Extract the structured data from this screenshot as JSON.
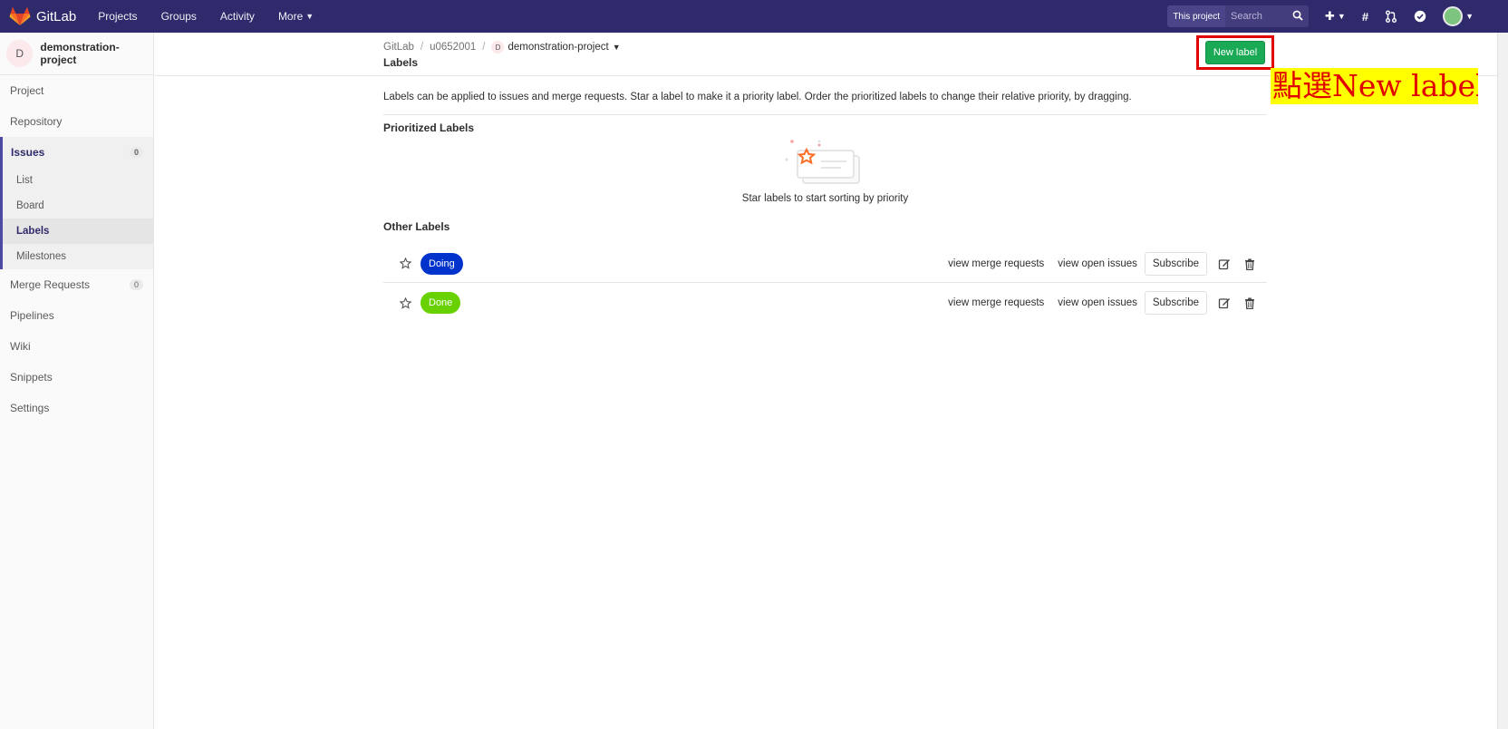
{
  "navbar": {
    "brand": "GitLab",
    "links": [
      {
        "label": "Projects"
      },
      {
        "label": "Groups"
      },
      {
        "label": "Activity"
      },
      {
        "label": "More"
      }
    ],
    "search_scope": "This project",
    "search_placeholder": "Search"
  },
  "sidebar": {
    "project_initial": "D",
    "project_name": "demonstration-project",
    "items": [
      {
        "label": "Project"
      },
      {
        "label": "Repository"
      },
      {
        "label": "Issues",
        "badge": "0"
      },
      {
        "label": "Merge Requests",
        "badge": "0"
      },
      {
        "label": "Pipelines"
      },
      {
        "label": "Wiki"
      },
      {
        "label": "Snippets"
      },
      {
        "label": "Settings"
      }
    ],
    "issues_sub": [
      {
        "label": "List"
      },
      {
        "label": "Board"
      },
      {
        "label": "Labels"
      },
      {
        "label": "Milestones"
      }
    ]
  },
  "breadcrumb": {
    "root": "GitLab",
    "user": "u0652001",
    "project_initial": "D",
    "project": "demonstration-project",
    "page_title": "Labels"
  },
  "header": {
    "new_label": "New label",
    "annotation": "點選New label"
  },
  "main": {
    "intro": "Labels can be applied to issues and merge requests. Star a label to make it a priority label. Order the prioritized labels to change their relative priority, by dragging.",
    "prioritized_title": "Prioritized Labels",
    "empty_text": "Star labels to start sorting by priority",
    "other_title": "Other Labels",
    "labels": [
      {
        "name": "Doing",
        "color": "#0033cc",
        "view_mr": "view merge requests",
        "view_issues": "view open issues",
        "subscribe": "Subscribe"
      },
      {
        "name": "Done",
        "color": "#69d100",
        "view_mr": "view merge requests",
        "view_issues": "view open issues",
        "subscribe": "Subscribe"
      }
    ]
  },
  "colors": {
    "navbar": "#2f2a6b",
    "accent": "#4b4ba3",
    "success": "#1aaa55",
    "highlight_box": "#e00000",
    "annotation_bg": "#ffff00"
  }
}
